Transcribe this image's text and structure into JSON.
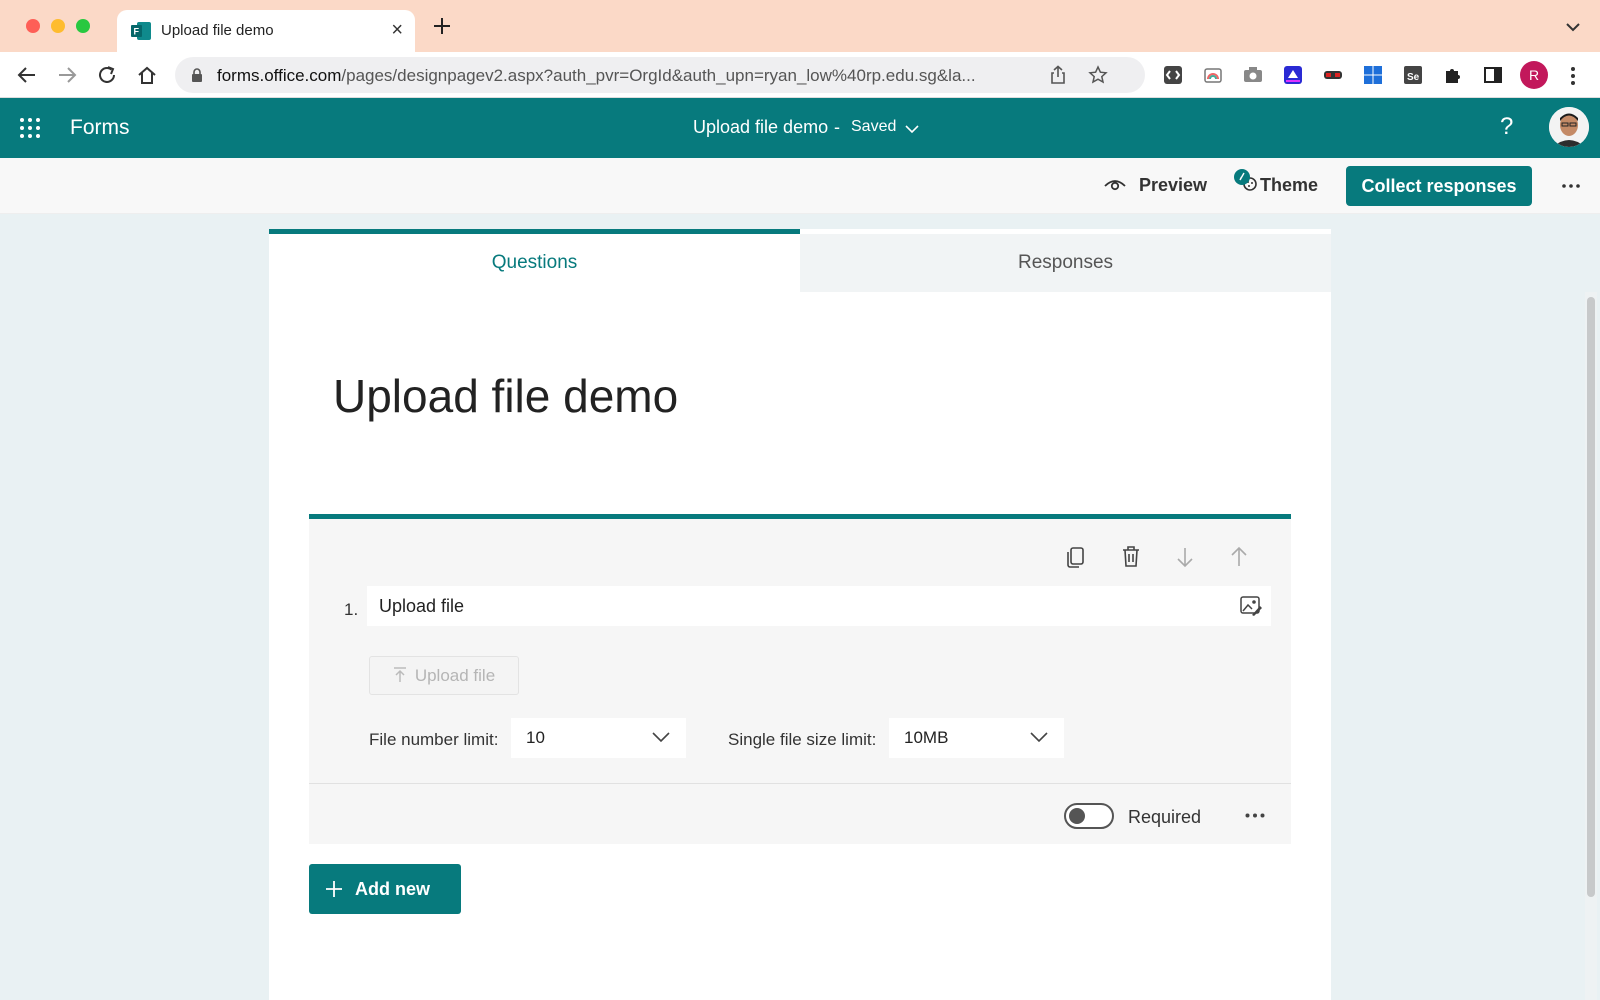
{
  "browser": {
    "tab_title": "Upload file demo",
    "url_host": "forms.office.com",
    "url_path": "/pages/designpagev2.aspx?auth_pvr=OrgId&auth_upn=ryan_low%40rp.edu.sg&la...",
    "profile_initial": "R",
    "extensions": [
      "devtools-icon",
      "color-picker-icon",
      "screenshot-icon",
      "speed-icon",
      "incognito-mask-icon",
      "windows-icon",
      "selenium-icon",
      "puzzle-icon",
      "sidepanel-icon"
    ]
  },
  "app": {
    "brand": "Forms",
    "doc_title": "Upload file demo",
    "doc_separator": "-",
    "doc_status": "Saved",
    "help": "?",
    "accent_color": "#077a7d"
  },
  "commands": {
    "preview": "Preview",
    "theme": "Theme",
    "collect": "Collect responses"
  },
  "tabs": {
    "questions": "Questions",
    "responses": "Responses"
  },
  "form": {
    "title": "Upload file demo",
    "question": {
      "number": "1.",
      "text": "Upload file",
      "upload_button": "Upload file",
      "file_number_label": "File number limit:",
      "file_number_value": "10",
      "file_size_label": "Single file size limit:",
      "file_size_value": "10MB",
      "required_label": "Required",
      "required_on": false
    },
    "add_new": "Add new"
  }
}
